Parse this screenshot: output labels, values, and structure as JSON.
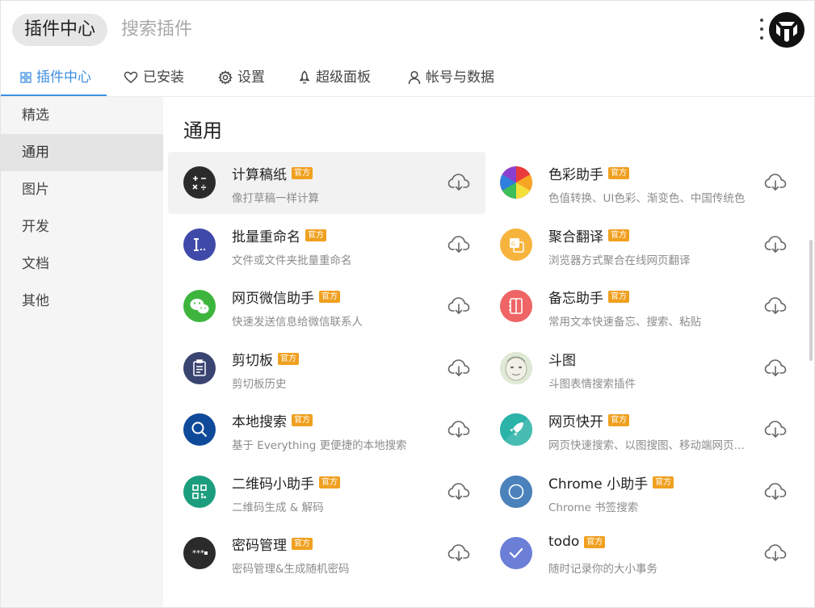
{
  "header": {
    "title": "插件中心",
    "search_placeholder": "搜索插件"
  },
  "tabs": [
    {
      "label": "插件中心",
      "icon": "grid-icon",
      "active": true
    },
    {
      "label": "已安装",
      "icon": "heart-icon"
    },
    {
      "label": "设置",
      "icon": "gear-icon"
    },
    {
      "label": "超级面板",
      "icon": "rocket-icon"
    },
    {
      "label": "帐号与数据",
      "icon": "user-icon"
    }
  ],
  "sidebar": {
    "items": [
      {
        "label": "精选"
      },
      {
        "label": "通用",
        "active": true
      },
      {
        "label": "图片"
      },
      {
        "label": "开发"
      },
      {
        "label": "文档"
      },
      {
        "label": "其他"
      }
    ]
  },
  "main": {
    "section_title": "通用",
    "plugins": [
      {
        "name": "计算稿纸",
        "badge": "官方",
        "desc": "像打草稿一样计算",
        "icon": "calculator-icon",
        "color": "#2b2b2b"
      },
      {
        "name": "色彩助手",
        "badge": "官方",
        "desc": "色值转换、UI色彩、渐变色、中国传统色",
        "icon": "color-wheel-icon",
        "color": "#e84c3d"
      },
      {
        "name": "批量重命名",
        "badge": "官方",
        "desc": "文件或文件夹批量重命名",
        "icon": "rename-icon",
        "color": "#3f4aa8"
      },
      {
        "name": "聚合翻译",
        "badge": "官方",
        "desc": "浏览器方式聚合在线网页翻译",
        "icon": "translate-icon",
        "color": "#f7b43c"
      },
      {
        "name": "网页微信助手",
        "badge": "官方",
        "desc": "快速发送信息给微信联系人",
        "icon": "wechat-icon",
        "color": "#3db53d"
      },
      {
        "name": "备忘助手",
        "badge": "官方",
        "desc": "常用文本快速备忘、搜索、粘贴",
        "icon": "notebook-icon",
        "color": "#ef6464"
      },
      {
        "name": "剪切板",
        "badge": "官方",
        "desc": "剪切板历史",
        "icon": "clipboard-icon",
        "color": "#3a4470"
      },
      {
        "name": "斗图",
        "badge": "",
        "desc": "斗图表情搜索插件",
        "icon": "meme-face-icon",
        "color": "#cfe0c5"
      },
      {
        "name": "本地搜索",
        "badge": "官方",
        "desc": "基于 Everything 更便捷的本地搜索",
        "icon": "search-icon",
        "color": "#0f4a9a"
      },
      {
        "name": "网页快开",
        "badge": "官方",
        "desc": "网页快速搜索、以图搜图、移动端网页调试",
        "icon": "rocket-icon",
        "color": "#2bb3a8"
      },
      {
        "name": "二维码小助手",
        "badge": "官方",
        "desc": "二维码生成 & 解码",
        "icon": "qrcode-icon",
        "color": "#1c9e7e"
      },
      {
        "name": "Chrome 小助手",
        "badge": "官方",
        "desc": "Chrome 书签搜索",
        "icon": "chrome-icon",
        "color": "#3a73b0"
      },
      {
        "name": "密码管理",
        "badge": "官方",
        "desc": "密码管理&生成随机密码",
        "icon": "password-icon",
        "color": "#2b2b2b"
      },
      {
        "name": "todo",
        "badge": "官方",
        "desc": "随时记录你的大小事务",
        "icon": "check-icon",
        "color": "#6b7fd7"
      }
    ]
  }
}
